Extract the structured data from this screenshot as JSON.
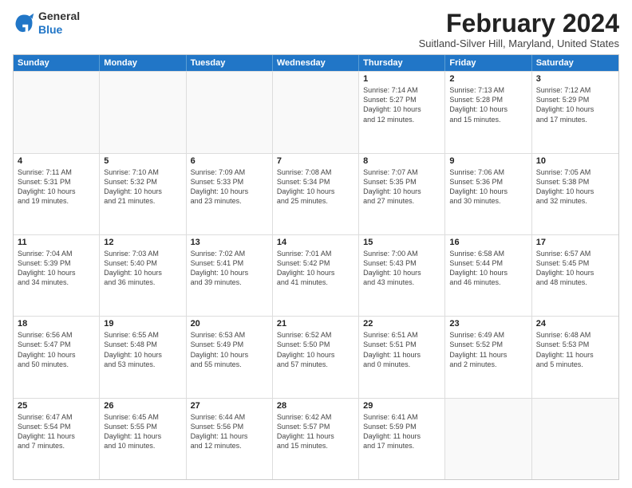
{
  "header": {
    "logo": {
      "line1": "General",
      "line2": "Blue"
    },
    "title": "February 2024",
    "location": "Suitland-Silver Hill, Maryland, United States"
  },
  "calendar": {
    "days_of_week": [
      "Sunday",
      "Monday",
      "Tuesday",
      "Wednesday",
      "Thursday",
      "Friday",
      "Saturday"
    ],
    "rows": [
      [
        {
          "day": "",
          "info": "",
          "empty": true
        },
        {
          "day": "",
          "info": "",
          "empty": true
        },
        {
          "day": "",
          "info": "",
          "empty": true
        },
        {
          "day": "",
          "info": "",
          "empty": true
        },
        {
          "day": "1",
          "info": "Sunrise: 7:14 AM\nSunset: 5:27 PM\nDaylight: 10 hours\nand 12 minutes.",
          "empty": false
        },
        {
          "day": "2",
          "info": "Sunrise: 7:13 AM\nSunset: 5:28 PM\nDaylight: 10 hours\nand 15 minutes.",
          "empty": false
        },
        {
          "day": "3",
          "info": "Sunrise: 7:12 AM\nSunset: 5:29 PM\nDaylight: 10 hours\nand 17 minutes.",
          "empty": false
        }
      ],
      [
        {
          "day": "4",
          "info": "Sunrise: 7:11 AM\nSunset: 5:31 PM\nDaylight: 10 hours\nand 19 minutes.",
          "empty": false
        },
        {
          "day": "5",
          "info": "Sunrise: 7:10 AM\nSunset: 5:32 PM\nDaylight: 10 hours\nand 21 minutes.",
          "empty": false
        },
        {
          "day": "6",
          "info": "Sunrise: 7:09 AM\nSunset: 5:33 PM\nDaylight: 10 hours\nand 23 minutes.",
          "empty": false
        },
        {
          "day": "7",
          "info": "Sunrise: 7:08 AM\nSunset: 5:34 PM\nDaylight: 10 hours\nand 25 minutes.",
          "empty": false
        },
        {
          "day": "8",
          "info": "Sunrise: 7:07 AM\nSunset: 5:35 PM\nDaylight: 10 hours\nand 27 minutes.",
          "empty": false
        },
        {
          "day": "9",
          "info": "Sunrise: 7:06 AM\nSunset: 5:36 PM\nDaylight: 10 hours\nand 30 minutes.",
          "empty": false
        },
        {
          "day": "10",
          "info": "Sunrise: 7:05 AM\nSunset: 5:38 PM\nDaylight: 10 hours\nand 32 minutes.",
          "empty": false
        }
      ],
      [
        {
          "day": "11",
          "info": "Sunrise: 7:04 AM\nSunset: 5:39 PM\nDaylight: 10 hours\nand 34 minutes.",
          "empty": false
        },
        {
          "day": "12",
          "info": "Sunrise: 7:03 AM\nSunset: 5:40 PM\nDaylight: 10 hours\nand 36 minutes.",
          "empty": false
        },
        {
          "day": "13",
          "info": "Sunrise: 7:02 AM\nSunset: 5:41 PM\nDaylight: 10 hours\nand 39 minutes.",
          "empty": false
        },
        {
          "day": "14",
          "info": "Sunrise: 7:01 AM\nSunset: 5:42 PM\nDaylight: 10 hours\nand 41 minutes.",
          "empty": false
        },
        {
          "day": "15",
          "info": "Sunrise: 7:00 AM\nSunset: 5:43 PM\nDaylight: 10 hours\nand 43 minutes.",
          "empty": false
        },
        {
          "day": "16",
          "info": "Sunrise: 6:58 AM\nSunset: 5:44 PM\nDaylight: 10 hours\nand 46 minutes.",
          "empty": false
        },
        {
          "day": "17",
          "info": "Sunrise: 6:57 AM\nSunset: 5:45 PM\nDaylight: 10 hours\nand 48 minutes.",
          "empty": false
        }
      ],
      [
        {
          "day": "18",
          "info": "Sunrise: 6:56 AM\nSunset: 5:47 PM\nDaylight: 10 hours\nand 50 minutes.",
          "empty": false
        },
        {
          "day": "19",
          "info": "Sunrise: 6:55 AM\nSunset: 5:48 PM\nDaylight: 10 hours\nand 53 minutes.",
          "empty": false
        },
        {
          "day": "20",
          "info": "Sunrise: 6:53 AM\nSunset: 5:49 PM\nDaylight: 10 hours\nand 55 minutes.",
          "empty": false
        },
        {
          "day": "21",
          "info": "Sunrise: 6:52 AM\nSunset: 5:50 PM\nDaylight: 10 hours\nand 57 minutes.",
          "empty": false
        },
        {
          "day": "22",
          "info": "Sunrise: 6:51 AM\nSunset: 5:51 PM\nDaylight: 11 hours\nand 0 minutes.",
          "empty": false
        },
        {
          "day": "23",
          "info": "Sunrise: 6:49 AM\nSunset: 5:52 PM\nDaylight: 11 hours\nand 2 minutes.",
          "empty": false
        },
        {
          "day": "24",
          "info": "Sunrise: 6:48 AM\nSunset: 5:53 PM\nDaylight: 11 hours\nand 5 minutes.",
          "empty": false
        }
      ],
      [
        {
          "day": "25",
          "info": "Sunrise: 6:47 AM\nSunset: 5:54 PM\nDaylight: 11 hours\nand 7 minutes.",
          "empty": false
        },
        {
          "day": "26",
          "info": "Sunrise: 6:45 AM\nSunset: 5:55 PM\nDaylight: 11 hours\nand 10 minutes.",
          "empty": false
        },
        {
          "day": "27",
          "info": "Sunrise: 6:44 AM\nSunset: 5:56 PM\nDaylight: 11 hours\nand 12 minutes.",
          "empty": false
        },
        {
          "day": "28",
          "info": "Sunrise: 6:42 AM\nSunset: 5:57 PM\nDaylight: 11 hours\nand 15 minutes.",
          "empty": false
        },
        {
          "day": "29",
          "info": "Sunrise: 6:41 AM\nSunset: 5:59 PM\nDaylight: 11 hours\nand 17 minutes.",
          "empty": false
        },
        {
          "day": "",
          "info": "",
          "empty": true
        },
        {
          "day": "",
          "info": "",
          "empty": true
        }
      ]
    ]
  }
}
